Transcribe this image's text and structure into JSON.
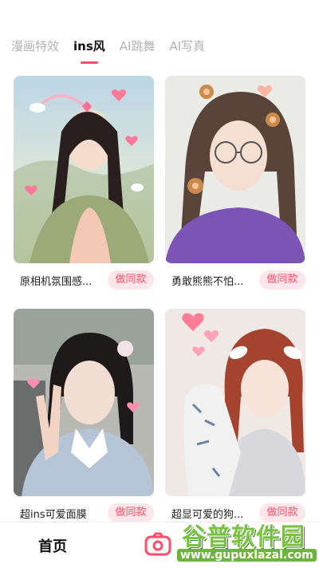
{
  "tabs": [
    {
      "label": "漫画特效"
    },
    {
      "label": "ins风",
      "active": true
    },
    {
      "label": "AI跳舞"
    },
    {
      "label": "AI写真"
    }
  ],
  "cards": [
    {
      "name": "原相机氛围感...",
      "action": "做同款"
    },
    {
      "name": "勇敢熊熊不怕...",
      "action": "做同款"
    },
    {
      "name": "超ins可爱面膜",
      "action": "做同款"
    },
    {
      "name": "超显可爱的狗...",
      "action": "做同款"
    }
  ],
  "bottom_nav": {
    "home_label": "首页"
  },
  "watermark": {
    "title": "谷普软件园",
    "url": "www.gupuxlazal.com"
  },
  "colors": {
    "accent": "#ff4d6a",
    "accent_bg": "#ffe6ea",
    "watermark_green": "#6db33f"
  }
}
